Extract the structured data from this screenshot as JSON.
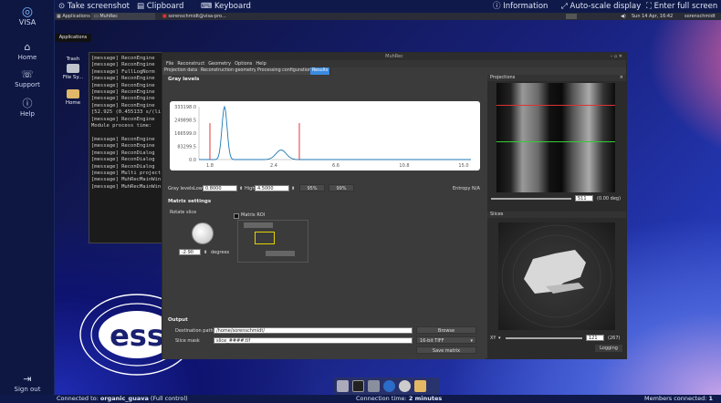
{
  "sidebar": {
    "brand": "VISA",
    "items": [
      {
        "label": "Home"
      },
      {
        "label": "Support"
      },
      {
        "label": "Help"
      }
    ],
    "signout": "Sign out"
  },
  "topbar": {
    "screenshot": "Take screenshot",
    "clipboard": "Clipboard",
    "keyboard": "Keyboard",
    "information": "Information",
    "autoscale": "Auto-scale display",
    "fullscreen": "Enter full screen"
  },
  "taskbar": {
    "applications": "Applications",
    "app1": "MuhRec",
    "app2": "sorenschmidt@visa-pro...",
    "clock": "Sun 14 Apr, 16:42",
    "user": "sorenschmidt"
  },
  "tooltip": "Applications",
  "desktop_icons": [
    {
      "label": "Trash"
    },
    {
      "label": "File Sy..."
    },
    {
      "label": "Home"
    }
  ],
  "terminal_lines": [
    "[message] ReconEngine",
    "[message] ReconEngine",
    "[message] FullLogNorm",
    "[message] ReconEngine",
    "[message] ReconEngine",
    "[message] ReconEngine",
    "[message] ReconEngine",
    "[message] ReconEngine",
    "[52.925 (0.455133 s/(li",
    "[message] ReconEngine",
    "Module process time:",
    "",
    "[message] ReconEngine",
    "[message] ReconEngine",
    "[message] ReconDialog",
    "[message] ReconDialog",
    "[message] ReconDialog",
    "[message] Multi project",
    "[message] MuhRecMainWin",
    "[message] MuhRecMainWin"
  ],
  "window": {
    "title": "MuhRec",
    "menu": [
      "File",
      "Reconstruct",
      "Geometry",
      "Options",
      "Help"
    ],
    "tabs": [
      "Projection data",
      "Reconstruction geometry",
      "Processing configuration",
      "Results"
    ],
    "gray_levels": "Gray levels",
    "matrix_settings": "Matrix settings",
    "rotate_slice": "Rotate slice",
    "matrix_roi": "Matrix ROI",
    "gray_label": "Gray levels",
    "low_label": "Low",
    "low_value": "0.8000",
    "high_label": "High",
    "high_value": "4.5000",
    "pct95": "95%",
    "pct99": "99%",
    "entropy": "Entropy N/A",
    "degrees_value": "-2.90",
    "degrees_label": "degrees",
    "output": "Output",
    "dest_label": "Destination path",
    "dest_value": "/home/sorenschmidt/",
    "browse": "Browse",
    "mask_label": "Slice mask",
    "mask_value": "slice_####.tif",
    "format": "16-bit TIFF",
    "save_matrix": "Save matrix",
    "projections": "Projections",
    "proj_index": "511",
    "proj_angle": "(0.00 deg)",
    "slices": "Slices",
    "slice_axis": "XY",
    "slice_index": "121",
    "slice_total": "(267)",
    "logging": "Logging"
  },
  "chart_data": {
    "type": "line",
    "yticks": [
      "333198.0",
      "249898.5",
      "166599.0",
      "83299.5",
      "0.0"
    ],
    "xticks": [
      "1.8",
      "2.4",
      "6.6",
      "10.8",
      "15.0"
    ]
  },
  "status": {
    "connected_prefix": "Connected to:",
    "host": "organic_guava",
    "mode": "(Full control)",
    "conn_time_label": "Connection time:",
    "conn_time": "2 minutes",
    "members_label": "Members connected:",
    "members": "1"
  }
}
